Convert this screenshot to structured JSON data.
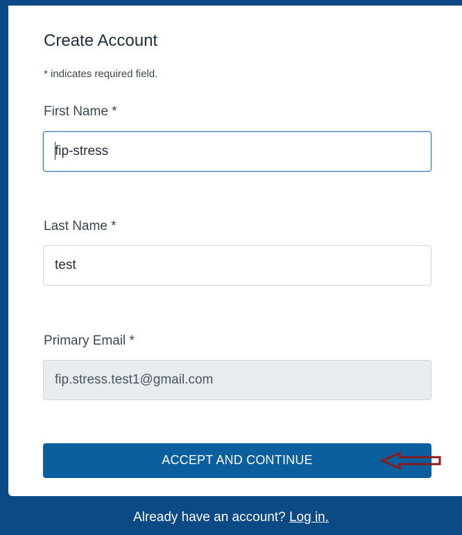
{
  "form": {
    "title": "Create Account",
    "required_note": "* indicates required field.",
    "first_name": {
      "label": "First Name *",
      "value": "fip-stress"
    },
    "last_name": {
      "label": "Last Name *",
      "value": "test"
    },
    "primary_email": {
      "label": "Primary Email *",
      "value": "fip.stress.test1@gmail.com"
    },
    "submit_label": "ACCEPT AND CONTINUE"
  },
  "footer": {
    "prompt": "Already have an account?",
    "login_link": "Log in."
  },
  "annotation": {
    "arrow_color": "#8b1a1a",
    "arrow_icon": "left-arrow-icon"
  },
  "colors": {
    "page_background": "#0b4a85",
    "button_background": "#0b5f9e",
    "focus_border": "#2f7ab8"
  }
}
